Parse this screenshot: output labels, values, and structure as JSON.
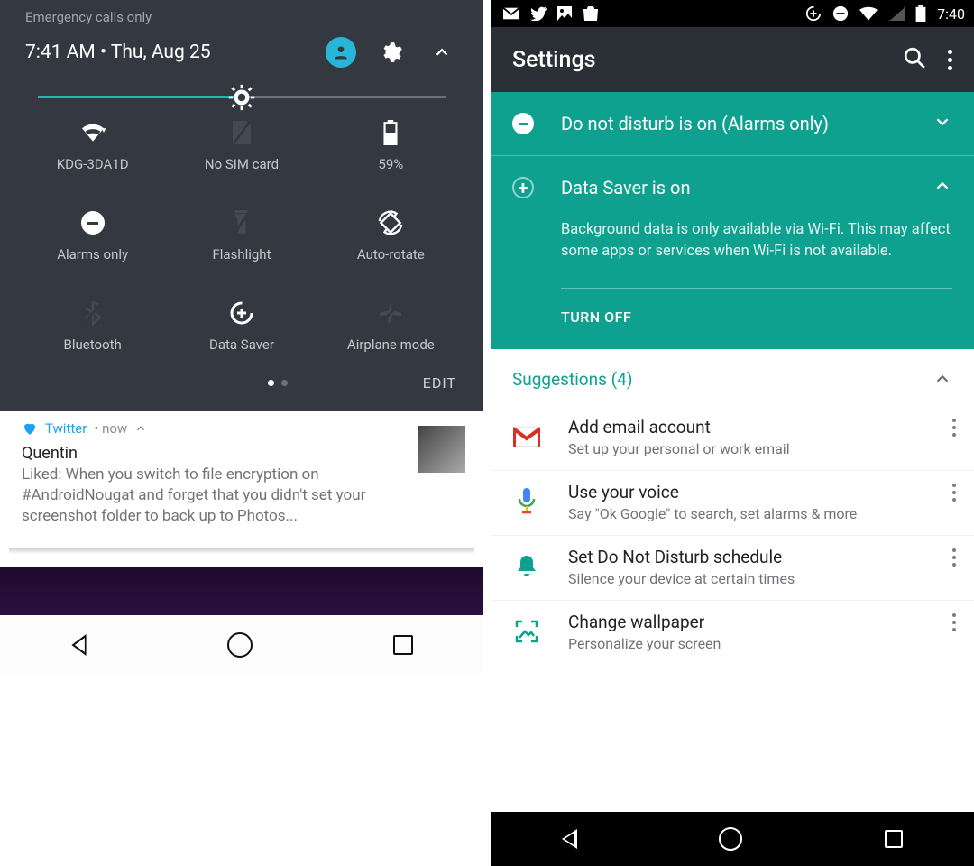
{
  "left": {
    "emergency": "Emergency calls only",
    "time_line": "7:41 AM  •  Thu, Aug 25",
    "brightness_pct": 50,
    "tiles": [
      {
        "label": "KDG-3DA1D"
      },
      {
        "label": "No SIM card"
      },
      {
        "label": "59%"
      },
      {
        "label": "Alarms only"
      },
      {
        "label": "Flashlight"
      },
      {
        "label": "Auto-rotate"
      },
      {
        "label": "Bluetooth"
      },
      {
        "label": "Data Saver"
      },
      {
        "label": "Airplane mode"
      }
    ],
    "edit": "EDIT",
    "notif": {
      "app": "Twitter",
      "meta": "• now",
      "title": "Quentin",
      "text": "Liked: When you switch to file encryption on #AndroidNougat and forget that you didn't set your screenshot folder to back up to Photos..."
    }
  },
  "right": {
    "status_time": "7:40",
    "appbar_title": "Settings",
    "banners": {
      "dnd": {
        "title": "Do not disturb is on (Alarms only)"
      },
      "datasaver": {
        "title": "Data Saver is on",
        "desc": "Background data is only available via Wi-Fi. This may affect some apps or services when Wi-Fi is not available.",
        "action": "TURN OFF"
      }
    },
    "suggestions_header": "Suggestions (4)",
    "suggestions": [
      {
        "title": "Add email account",
        "sub": "Set up your personal or work email"
      },
      {
        "title": "Use your voice",
        "sub": "Say \"Ok Google\" to search, set alarms & more"
      },
      {
        "title": "Set Do Not Disturb schedule",
        "sub": "Silence your device at certain times"
      },
      {
        "title": "Change wallpaper",
        "sub": "Personalize your screen"
      }
    ]
  }
}
